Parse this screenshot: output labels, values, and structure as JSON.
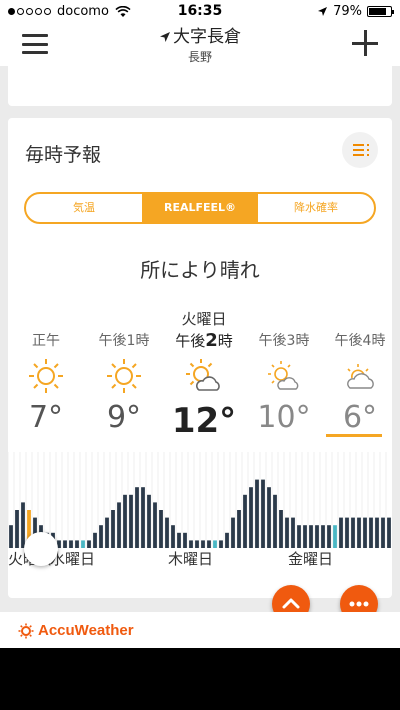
{
  "status_bar": {
    "carrier": "docomo",
    "time": "16:35",
    "battery": "79%",
    "battery_level": 0.79,
    "signal_bars": 1
  },
  "header": {
    "location": "大字長倉",
    "region": "長野",
    "icons": [
      "menu-icon",
      "location-arrow-icon",
      "plus-icon"
    ]
  },
  "forecast": {
    "title": "毎時予報",
    "tabs": [
      "気温",
      "REALFEEL®",
      "降水確率"
    ],
    "active_tab": 1,
    "condition": "所により晴れ",
    "hours": [
      {
        "day": "",
        "label": "正午",
        "icon": "sun-icon",
        "temp": "7°"
      },
      {
        "day": "",
        "label": "午後1時",
        "icon": "sun-icon",
        "temp": "9°"
      },
      {
        "day": "火曜日",
        "label_prefix": "午後",
        "label_num": "2",
        "label_suffix": "時",
        "icon": "partly-sunny-icon",
        "temp": "12°"
      },
      {
        "day": "",
        "label": "午後3時",
        "icon": "partly-sunny-icon",
        "temp": "10°"
      },
      {
        "day": "",
        "label": "午後4時",
        "icon": "cloudy-sun-icon",
        "temp": "6°"
      }
    ],
    "day_labels": [
      "火曜日",
      "水曜日",
      "木曜日",
      "金曜日"
    ]
  },
  "chart_data": {
    "type": "bar",
    "values": [
      3,
      5,
      6,
      5,
      4,
      3,
      2,
      2,
      1,
      1,
      1,
      1,
      1,
      1,
      2,
      3,
      4,
      5,
      6,
      7,
      7,
      8,
      8,
      7,
      6,
      5,
      4,
      3,
      2,
      2,
      1,
      1,
      1,
      1,
      1,
      1,
      2,
      4,
      5,
      7,
      8,
      9,
      9,
      8,
      7,
      5,
      4,
      4,
      3,
      3,
      3,
      3,
      3,
      3,
      3,
      4,
      4,
      4,
      4,
      4,
      4,
      4,
      4,
      4
    ],
    "highlight_index": 3,
    "selected_index": 12
  },
  "colors": {
    "accent": "#f5a623",
    "brand": "#f05a0f",
    "bar": "#2b3a4a",
    "highlight_bar": "#f5a623",
    "current_bar": "#4ab7c4"
  },
  "footer": {
    "brand": "AccuWeather"
  }
}
